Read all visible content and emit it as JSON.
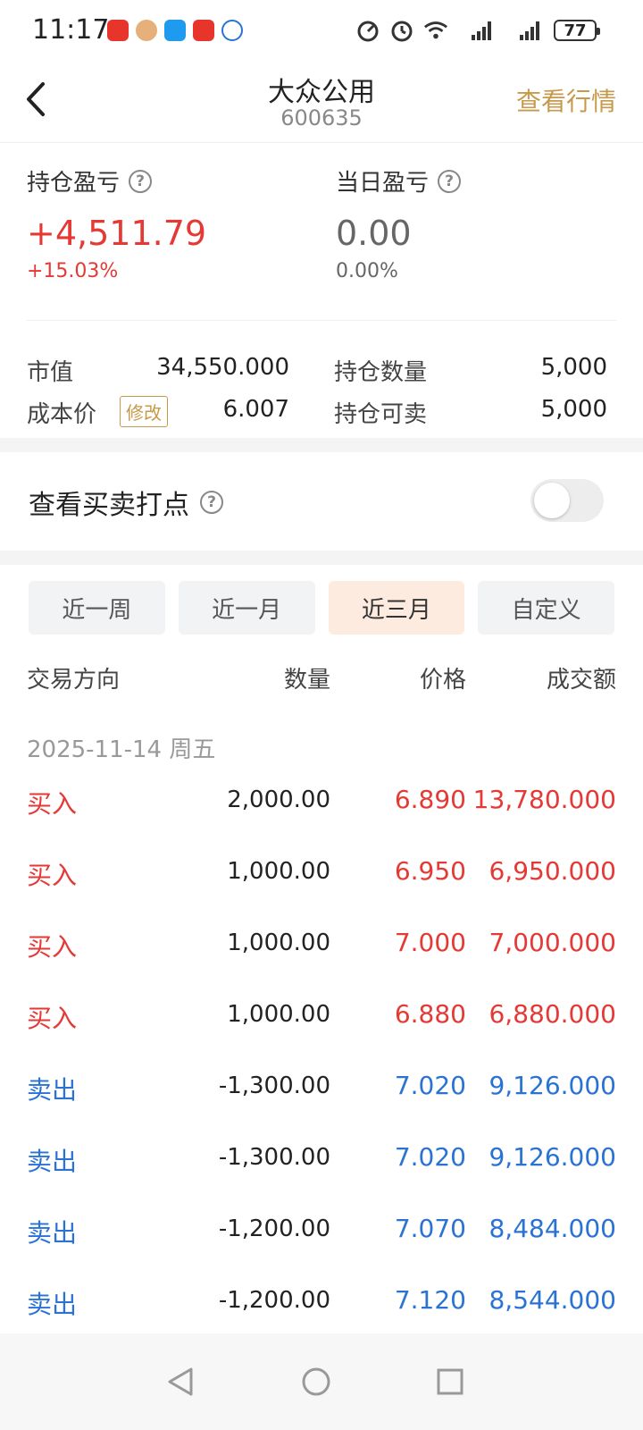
{
  "status_bar": {
    "time": "11:17",
    "battery": "77",
    "network": [
      "4G",
      "4G"
    ]
  },
  "header": {
    "title": "大众公用",
    "code": "600635",
    "quote_link": "查看行情"
  },
  "profit": {
    "position_pl": {
      "label": "持仓盈亏",
      "value": "+4,511.79",
      "pct": "+15.03%"
    },
    "daily_pl": {
      "label": "当日盈亏",
      "value": "0.00",
      "pct": "0.00%"
    }
  },
  "stats": {
    "market_value": {
      "label": "市值",
      "value": "34,550.000"
    },
    "cost_price": {
      "label": "成本价",
      "edit": "修改",
      "value": "6.007"
    },
    "position_qty": {
      "label": "持仓数量",
      "value": "5,000"
    },
    "sellable_qty": {
      "label": "持仓可卖",
      "value": "5,000"
    }
  },
  "toggle": {
    "label": "查看买卖打点",
    "on": false
  },
  "tabs": [
    {
      "label": "近一周",
      "active": false
    },
    {
      "label": "近一月",
      "active": false
    },
    {
      "label": "近三月",
      "active": true
    },
    {
      "label": "自定义",
      "active": false
    }
  ],
  "table": {
    "headers": [
      "交易方向",
      "数量",
      "价格",
      "成交额"
    ],
    "date": "2025-11-14 周五",
    "rows": [
      {
        "dir": "买入",
        "qty": "2,000.00",
        "price": "6.890",
        "amount": "13,780.000",
        "type": "buy"
      },
      {
        "dir": "买入",
        "qty": "1,000.00",
        "price": "6.950",
        "amount": "6,950.000",
        "type": "buy"
      },
      {
        "dir": "买入",
        "qty": "1,000.00",
        "price": "7.000",
        "amount": "7,000.000",
        "type": "buy"
      },
      {
        "dir": "买入",
        "qty": "1,000.00",
        "price": "6.880",
        "amount": "6,880.000",
        "type": "buy"
      },
      {
        "dir": "卖出",
        "qty": "-1,300.00",
        "price": "7.020",
        "amount": "9,126.000",
        "type": "sell"
      },
      {
        "dir": "卖出",
        "qty": "-1,300.00",
        "price": "7.020",
        "amount": "9,126.000",
        "type": "sell"
      },
      {
        "dir": "卖出",
        "qty": "-1,200.00",
        "price": "7.070",
        "amount": "8,484.000",
        "type": "sell"
      },
      {
        "dir": "卖出",
        "qty": "-1,200.00",
        "price": "7.120",
        "amount": "8,544.000",
        "type": "sell"
      }
    ]
  },
  "colors": {
    "up": "#E53935",
    "down": "#2A73D4",
    "accent": "#C79A4B"
  }
}
